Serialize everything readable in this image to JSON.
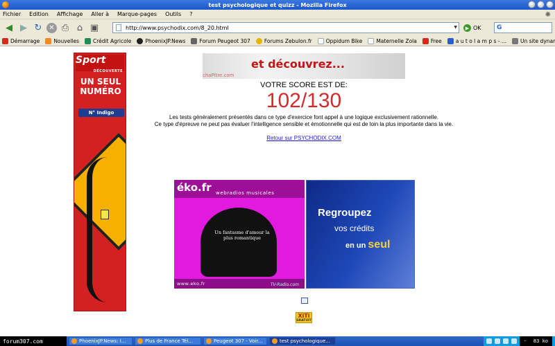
{
  "window": {
    "title": "test psychologique et quizz - Mozilla Firefox"
  },
  "menu": {
    "items": [
      "Fichier",
      "Edition",
      "Affichage",
      "Aller à",
      "Marque-pages",
      "Outils",
      "?"
    ]
  },
  "navbar": {
    "url": "http://www.psychodix.com/8_20.html",
    "ok_label": "OK"
  },
  "bookmarks": [
    {
      "label": "Démarrage",
      "color": "#d8281e"
    },
    {
      "label": "Nouvelles",
      "color": "#f08c1b"
    },
    {
      "label": "Crédit Agricole",
      "color": "#1f8f5a"
    },
    {
      "label": "PhoenixJP.News",
      "color": "#222222"
    },
    {
      "label": "Forum Peugeot 307",
      "color": "#666666"
    },
    {
      "label": "Forums Zebulon.fr",
      "color": "#e5b500"
    },
    {
      "label": "Oppidum Bike",
      "color": "#c9c9c9"
    },
    {
      "label": "Maternelle Zola",
      "color": "#c9c9c9"
    },
    {
      "label": "Free",
      "color": "#d8281e"
    },
    {
      "label": "a u t o l a m p s - ...",
      "color": "#2a5fc8"
    },
    {
      "label": "Un site dynamiqu...",
      "color": "#777777"
    }
  ],
  "bookmarks_more": "»",
  "ads": {
    "left_logo": "Sport",
    "left_logo_sub": "DÉCOUVERTE",
    "left_line1": "UN SEUL",
    "left_line2": "NUMÉRO",
    "left_indigo": "N° Indigo",
    "top_banner_text": "et découvrez...",
    "top_banner_brand": "chaPitre.com",
    "eko_brand": "éko.fr",
    "eko_tag": "webradios musicales",
    "eko_line": "Un fantasme d'amour la plus romantique",
    "eko_url": "www.eko.fr",
    "eko_tv": "TV-Radio.com",
    "credits_line1": "Regroupez",
    "credits_line2": "vos crédits",
    "credits_line3_a": "en un",
    "credits_line3_b": "seul",
    "xiti": "XiTi",
    "xiti_sub": "GRATUIT"
  },
  "result": {
    "label": "VOTRE SCORE EST DE:",
    "score": "102/130",
    "desc_line1": "Les tests généralement présentés dans ce type d'exercice font appel à une logique exclusivement rationnelle.",
    "desc_line2": "Ce type d'épreuve ne peut pas évaluer l'intelligence sensible et émotionnelle qui est de loin la plus importante dans la vie.",
    "back_link": "Retour sur PSYCHODIX.COM"
  },
  "taskbar": {
    "start_label": "forum307.com",
    "items": [
      {
        "label": "PhoenixJP.News: I...",
        "active": false
      },
      {
        "label": "Plus de France Tél...",
        "active": false
      },
      {
        "label": "Peugeot 307 - Voir...",
        "active": false
      },
      {
        "label": "test psychologique...",
        "active": true
      }
    ],
    "net_speed": "83 ko"
  }
}
